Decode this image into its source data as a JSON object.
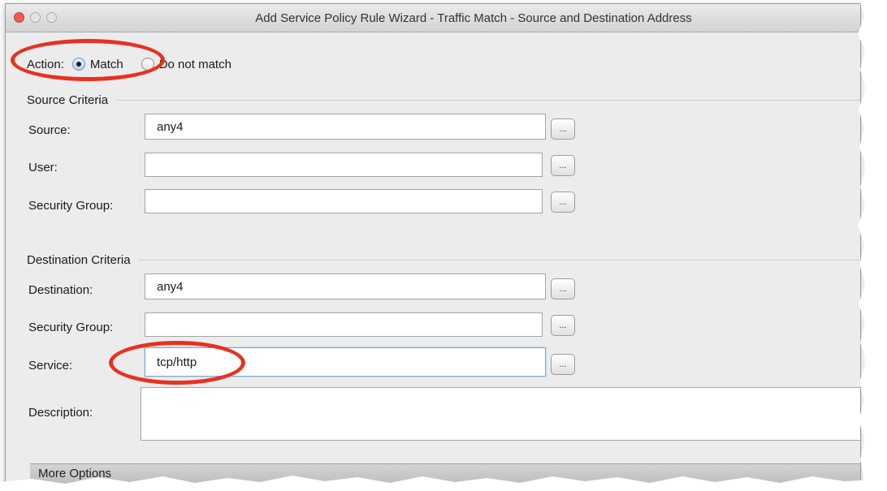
{
  "window": {
    "title": "Add Service Policy Rule Wizard - Traffic Match - Source and Destination Address"
  },
  "action": {
    "label": "Action:",
    "options": [
      {
        "label": "Match",
        "selected": true
      },
      {
        "label": "Do not match",
        "selected": false
      }
    ]
  },
  "source_criteria": {
    "heading": "Source Criteria",
    "source": {
      "label": "Source:",
      "value": "any4"
    },
    "user": {
      "label": "User:",
      "value": ""
    },
    "security_group": {
      "label": "Security Group:",
      "value": ""
    }
  },
  "destination_criteria": {
    "heading": "Destination Criteria",
    "destination": {
      "label": "Destination:",
      "value": "any4"
    },
    "security_group": {
      "label": "Security Group:",
      "value": ""
    },
    "service": {
      "label": "Service:",
      "value": "tcp/http"
    },
    "description": {
      "label": "Description:",
      "value": ""
    }
  },
  "browse_label": "...",
  "more_options": {
    "label": "More Options"
  },
  "annotation_color": "#e8311f"
}
